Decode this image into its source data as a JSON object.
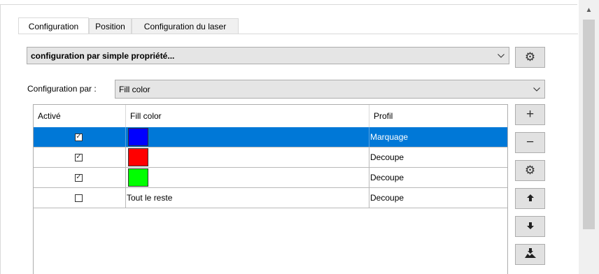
{
  "tabs": [
    {
      "label": "Configuration"
    },
    {
      "label": "Position"
    },
    {
      "label": "Configuration du laser"
    }
  ],
  "mode_combo": {
    "value": "configuration par simple propriété..."
  },
  "config_by": {
    "label": "Configuration par :",
    "value": "Fill color"
  },
  "table": {
    "headers": [
      "Activé",
      "Fill color",
      "Profil"
    ],
    "rows": [
      {
        "checked": true,
        "color": "#0000ff",
        "fill_label": "",
        "profile": "Marquage",
        "selected": true
      },
      {
        "checked": true,
        "color": "#ff0000",
        "fill_label": "",
        "profile": "Decoupe",
        "selected": false
      },
      {
        "checked": true,
        "color": "#00ff00",
        "fill_label": "",
        "profile": "Decoupe",
        "selected": false
      },
      {
        "checked": false,
        "color": "",
        "fill_label": "Tout le reste",
        "profile": "Decoupe",
        "selected": false
      }
    ]
  },
  "side_buttons": {
    "add": "+",
    "remove": "−",
    "settings": "⚙",
    "move_up": "🡅",
    "move_down": "🡇",
    "import": "⇩"
  },
  "colors": {
    "selection": "#0078d7"
  }
}
